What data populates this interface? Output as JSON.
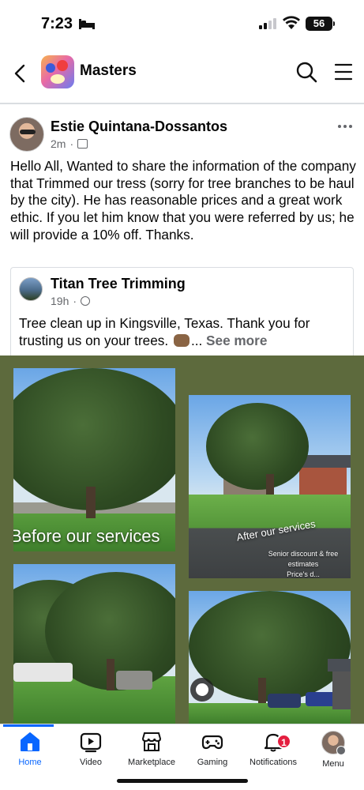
{
  "status_bar": {
    "time": "7:23",
    "battery": "56"
  },
  "header": {
    "title": "Masters"
  },
  "post": {
    "author": "Estie Quintana-Dossantos",
    "time_ago": "2m",
    "text": "Hello All, Wanted to share the information of the company that Trimmed our tress (sorry for tree branches to be haul by the city). He has reasonable prices and a great work ethic. If you let him know that you were referred by us; he will provide a 10% off. Thanks."
  },
  "shared": {
    "page_name": "Titan Tree Trimming",
    "time_ago": "19h",
    "text": "Tree clean up in Kingsville, Texas. Thank you for trusting us on your trees.",
    "ellipsis": "...",
    "see_more": "See more"
  },
  "media": {
    "before_label": "Before our services",
    "after_label": "After our services",
    "promo_line1": "Senior discount & free",
    "promo_line2": "estimates",
    "promo_line3": "Price's d..."
  },
  "tabs": [
    {
      "label": "Home",
      "icon": "home-icon",
      "active": true
    },
    {
      "label": "Video",
      "icon": "video-icon"
    },
    {
      "label": "Marketplace",
      "icon": "marketplace-icon"
    },
    {
      "label": "Gaming",
      "icon": "gaming-icon"
    },
    {
      "label": "Notifications",
      "icon": "bell-icon",
      "badge": "1"
    },
    {
      "label": "Menu",
      "icon": "profile-menu-icon"
    }
  ],
  "colors": {
    "accent": "#0866ff",
    "badge": "#e41e3f",
    "media_bg": "#5d6a3d"
  }
}
